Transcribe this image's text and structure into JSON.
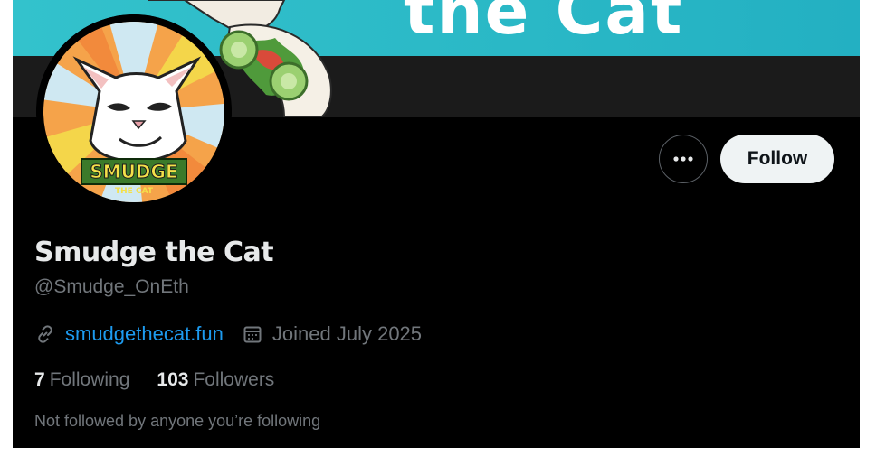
{
  "banner": {
    "title": "the Cat"
  },
  "avatar": {
    "badge_text": "SMUDGE",
    "badge_subtext": "THE CAT"
  },
  "actions": {
    "more_label": "More",
    "follow_label": "Follow"
  },
  "profile": {
    "display_name": "Smudge the Cat",
    "handle": "@Smudge_OnEth",
    "website": "smudgethecat.fun",
    "joined": "Joined July 2025",
    "following_count": "7",
    "following_label": "Following",
    "followers_count": "103",
    "followers_label": "Followers",
    "followed_note": "Not followed by anyone you’re following"
  },
  "colors": {
    "background": "#000000",
    "link": "#1d9bf0",
    "muted": "#71767b",
    "banner_teal": "#2ab8c6",
    "follow_button_bg": "#eff3f4"
  },
  "icons": [
    "ellipsis-icon",
    "link-icon",
    "calendar-icon"
  ]
}
